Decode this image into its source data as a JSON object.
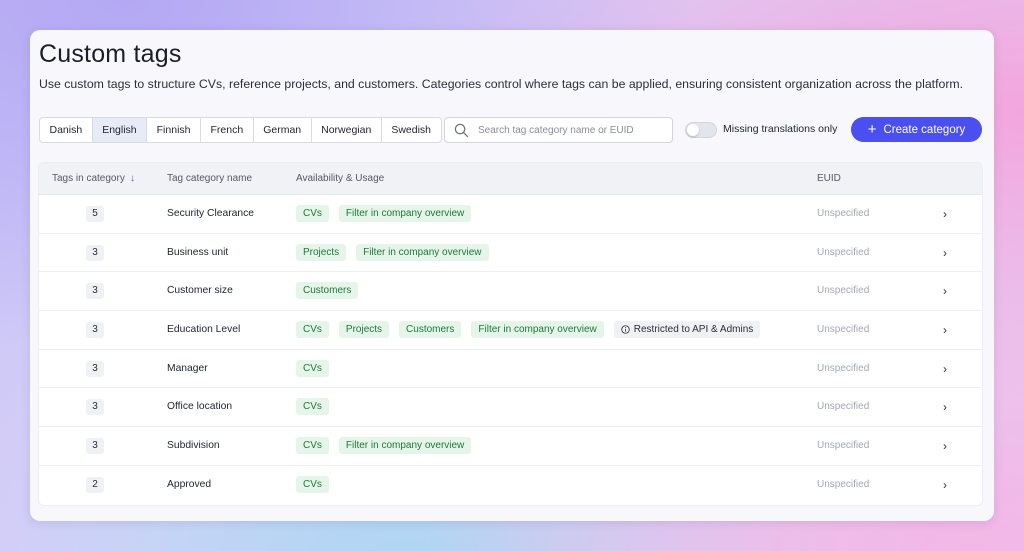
{
  "page": {
    "title": "Custom tags",
    "description": "Use custom tags to structure CVs, reference projects, and customers. Categories control where tags can be applied, ensuring consistent organization across the platform."
  },
  "languages": [
    "Danish",
    "English",
    "Finnish",
    "French",
    "German",
    "Norwegian",
    "Swedish"
  ],
  "active_language": "English",
  "search": {
    "placeholder": "Search tag category name or EUID",
    "value": ""
  },
  "toggle": {
    "label": "Missing translations only",
    "on": false
  },
  "create_button": {
    "label": "Create category",
    "icon": "plus-icon"
  },
  "table": {
    "headers": {
      "tags_in_category": "Tags in category",
      "name": "Tag category name",
      "availability": "Availability & Usage",
      "euid": "EUID"
    },
    "sort_icon": "arrow-down-icon",
    "rows": [
      {
        "count": "5",
        "name": "Security Clearance",
        "tags": [
          {
            "label": "CVs",
            "style": "green"
          },
          {
            "label": "Filter in company overview",
            "style": "green"
          }
        ],
        "euid": "Unspecified"
      },
      {
        "count": "3",
        "name": "Business unit",
        "tags": [
          {
            "label": "Projects",
            "style": "green"
          },
          {
            "label": "Filter in company overview",
            "style": "green"
          }
        ],
        "euid": "Unspecified"
      },
      {
        "count": "3",
        "name": "Customer size",
        "tags": [
          {
            "label": "Customers",
            "style": "green"
          }
        ],
        "euid": "Unspecified"
      },
      {
        "count": "3",
        "name": "Education Level",
        "tags": [
          {
            "label": "CVs",
            "style": "green"
          },
          {
            "label": "Projects",
            "style": "green"
          },
          {
            "label": "Customers",
            "style": "green"
          },
          {
            "label": "Filter in company overview",
            "style": "green"
          },
          {
            "label": "Restricted to API & Admins",
            "style": "gray",
            "icon": "info-icon"
          }
        ],
        "euid": "Unspecified"
      },
      {
        "count": "3",
        "name": "Manager",
        "tags": [
          {
            "label": "CVs",
            "style": "green"
          }
        ],
        "euid": "Unspecified"
      },
      {
        "count": "3",
        "name": "Office location",
        "tags": [
          {
            "label": "CVs",
            "style": "green"
          }
        ],
        "euid": "Unspecified"
      },
      {
        "count": "3",
        "name": "Subdivision",
        "tags": [
          {
            "label": "CVs",
            "style": "green"
          },
          {
            "label": "Filter in company overview",
            "style": "green"
          }
        ],
        "euid": "Unspecified"
      },
      {
        "count": "2",
        "name": "Approved",
        "tags": [
          {
            "label": "CVs",
            "style": "green"
          }
        ],
        "euid": "Unspecified"
      }
    ]
  },
  "colors": {
    "accent": "#4a4ff0",
    "tag_green_bg": "#e5f5e9",
    "tag_green_text": "#1f7a3a"
  }
}
